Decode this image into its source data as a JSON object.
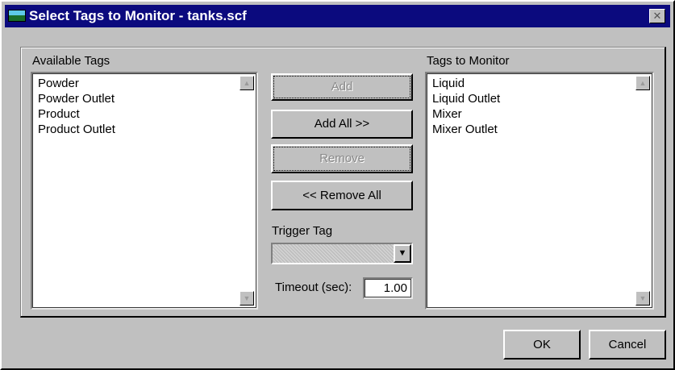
{
  "window": {
    "title": "Select Tags to Monitor - tanks.scf",
    "close_label": "✕"
  },
  "available": {
    "label": "Available Tags",
    "items": [
      "Powder",
      "Powder Outlet",
      "Product",
      "Product Outlet"
    ]
  },
  "monitor": {
    "label": "Tags to Monitor",
    "items": [
      "Liquid",
      "Liquid Outlet",
      "Mixer",
      "Mixer Outlet"
    ]
  },
  "buttons": {
    "add": "Add",
    "add_all": "Add All >>",
    "remove": "Remove",
    "remove_all": "<< Remove All",
    "ok": "OK",
    "cancel": "Cancel"
  },
  "trigger": {
    "label": "Trigger Tag",
    "value": ""
  },
  "timeout": {
    "label": "Timeout (sec):",
    "value": "1.00"
  },
  "icons": {
    "scroll_up": "▲",
    "scroll_down": "▼",
    "combo_arrow": "▼"
  }
}
